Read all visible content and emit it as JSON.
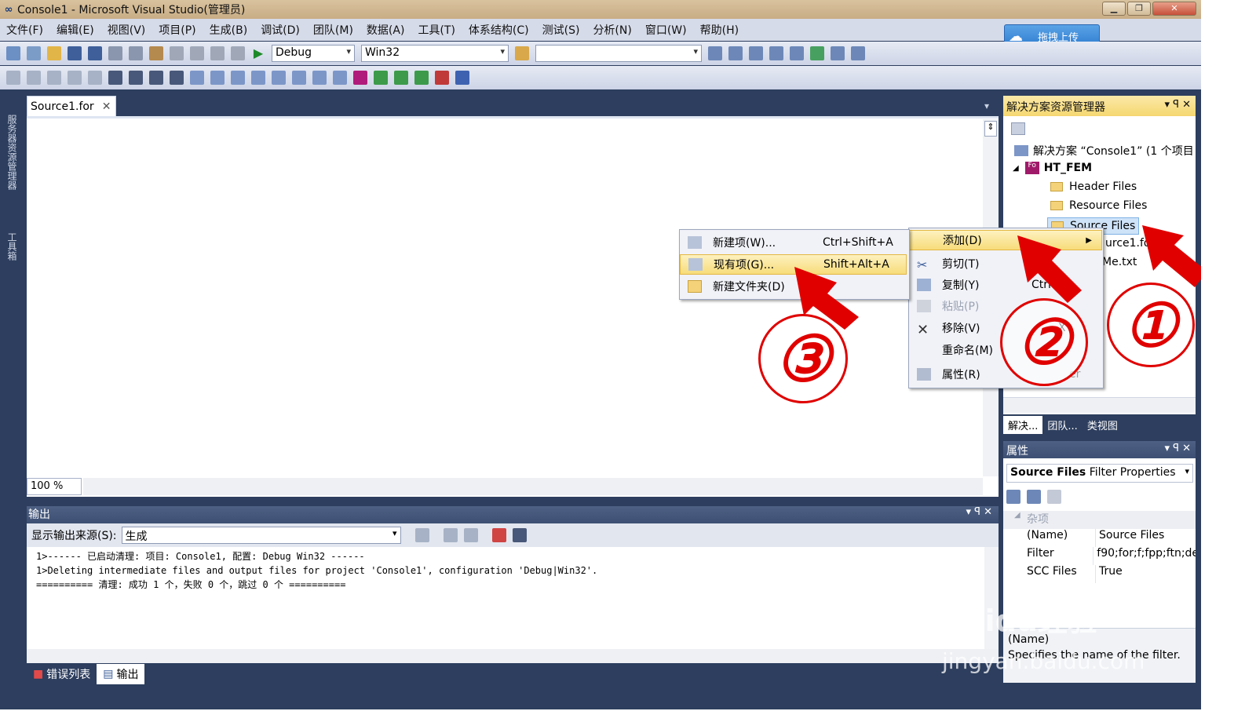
{
  "window": {
    "title": "Console1 - Microsoft Visual Studio(管理员)",
    "logo": "∞"
  },
  "menus": [
    "文件(F)",
    "编辑(E)",
    "视图(V)",
    "项目(P)",
    "生成(B)",
    "调试(D)",
    "团队(M)",
    "数据(A)",
    "工具(T)",
    "体系结构(C)",
    "测试(S)",
    "分析(N)",
    "窗口(W)",
    "帮助(H)"
  ],
  "upload_button": "拖拽上传",
  "toolbar": {
    "config": "Debug",
    "platform": "Win32",
    "search": ""
  },
  "left_strip": {
    "server_explorer": "服务器资源管理器",
    "toolbox": "工具箱"
  },
  "editor": {
    "tab": "Source1.for",
    "zoom": "100 %"
  },
  "output": {
    "title": "输出",
    "source_label": "显示输出来源(S):",
    "source_value": "生成",
    "lines": [
      "1>------ 已启动清理: 项目: Console1, 配置: Debug Win32 ------",
      "1>Deleting intermediate files and output files for project 'Console1', configuration 'Debug|Win32'.",
      "========== 清理: 成功 1 个，失败 0 个，跳过 0 个 =========="
    ],
    "tabs": [
      "错误列表",
      "输出"
    ]
  },
  "solution": {
    "title": "解决方案资源管理器",
    "root": "解决方案 “Console1” (1 个项目",
    "project": "HT_FEM",
    "folders": [
      "Header Files",
      "Resource Files",
      "Source Files"
    ],
    "file1": "urce1.fo",
    "file2": "Me.txt",
    "tabs": [
      "解决...",
      "团队...",
      "类视图"
    ]
  },
  "properties": {
    "title": "属性",
    "object_name": "Source Files",
    "object_type": "Filter Properties",
    "category": "杂项",
    "rows": [
      {
        "k": "(Name)",
        "v": "Source Files"
      },
      {
        "k": "Filter",
        "v": "f90;for;f;fpp;ftn;de"
      },
      {
        "k": "SCC Files",
        "v": "True"
      }
    ],
    "desc_title": "(Name)",
    "desc_text": "Specifies the name of the filter."
  },
  "context_menu": {
    "add": "添加(D)",
    "cut": "剪切(T)",
    "copy": "复制(Y)",
    "copy_sc": "Ctrl",
    "paste": "粘贴(P)",
    "remove": "移除(V)",
    "remove_sc": "X",
    "rename": "重命名(M)",
    "properties": "属性(R)",
    "properties_sc": "er"
  },
  "submenu": {
    "new_item": "新建项(W)...",
    "new_item_sc": "Ctrl+Shift+A",
    "existing_item": "现有项(G)...",
    "existing_item_sc": "Shift+Alt+A",
    "new_folder": "新建文件夹(D)"
  },
  "annotations": [
    "①",
    "②",
    "③"
  ],
  "watermark": {
    "line1": "Baidu经验",
    "line2": "jingyan.baidu.com"
  },
  "colors": {
    "accent_red": "#e00000",
    "highlight": "#f7dc7a",
    "frame": "#2d3e5e"
  }
}
